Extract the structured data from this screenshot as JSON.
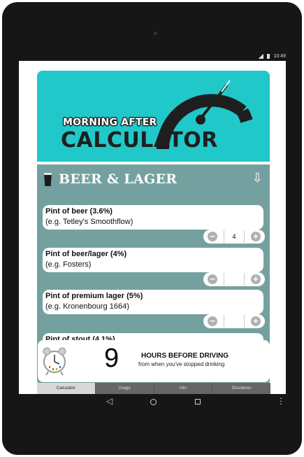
{
  "status": {
    "time": "10:49"
  },
  "app": {
    "logo_top": "MORNING AFTER",
    "logo_main": "CALCULATOR"
  },
  "section": {
    "title": "BEER & LAGER"
  },
  "items": [
    {
      "name": "Pint of beer (3.6%)",
      "example": "(e.g. Tetley's Smoothflow)",
      "qty": "4"
    },
    {
      "name": "Pint of beer/lager (4%)",
      "example": "(e.g. Fosters)",
      "qty": ""
    },
    {
      "name": "Pint of premium lager (5%)",
      "example": "(e.g. Kronenbourg 1664)",
      "qty": ""
    },
    {
      "name": "Pint of stout (4.1%)"
    }
  ],
  "result": {
    "hours": "9",
    "label": "HOURS BEFORE DRIVING",
    "sub": "from when you've stopped drinking"
  },
  "tabs": [
    {
      "label": "Calculator"
    },
    {
      "label": "Usage"
    },
    {
      "label": "Info"
    },
    {
      "label": "Disclaimer"
    }
  ],
  "colors": {
    "header": "#21c8c9",
    "panel": "#74a1a0",
    "tabs": "#666666"
  }
}
